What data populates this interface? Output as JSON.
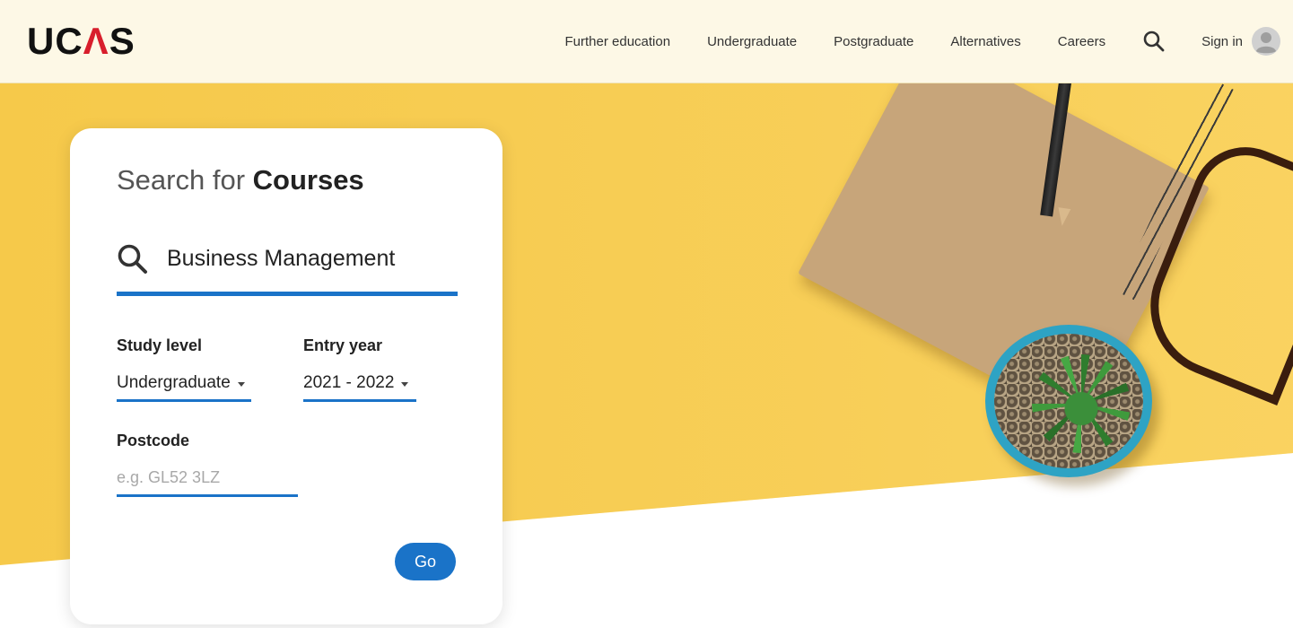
{
  "header": {
    "logo": {
      "prefix": "UC",
      "accent": "Λ",
      "suffix": "S"
    },
    "nav_items": [
      {
        "label": "Further education"
      },
      {
        "label": "Undergraduate"
      },
      {
        "label": "Postgraduate"
      },
      {
        "label": "Alternatives"
      },
      {
        "label": "Careers"
      }
    ],
    "search_icon": "search-icon",
    "sign_in_label": "Sign in",
    "avatar_icon": "user-avatar-icon"
  },
  "search_card": {
    "title_prefix": "Search for ",
    "title_strong": "Courses",
    "search": {
      "icon": "search-icon",
      "value": "Business Management"
    },
    "study_level": {
      "label": "Study level",
      "selected": "Undergraduate"
    },
    "entry_year": {
      "label": "Entry year",
      "selected": "2021 - 2022"
    },
    "postcode": {
      "label": "Postcode",
      "value": "",
      "placeholder": "e.g. GL52 3LZ"
    },
    "go_label": "Go"
  },
  "colors": {
    "brand_blue": "#1a73c8",
    "logo_accent": "#d81e2c",
    "hero_yellow": "#f6c94a",
    "header_bg": "#fdf8e6"
  }
}
